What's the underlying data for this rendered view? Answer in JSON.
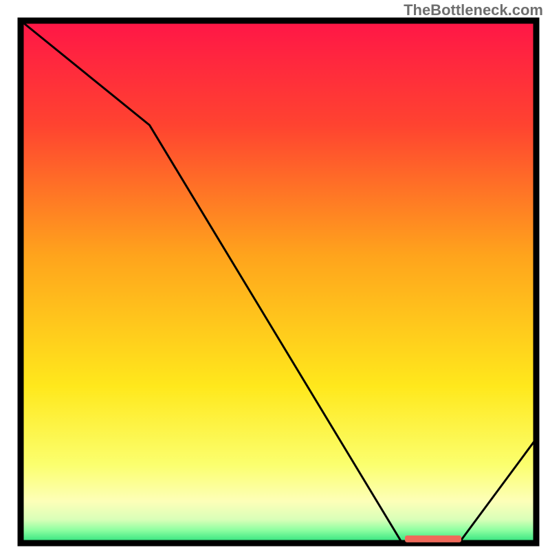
{
  "watermark": "TheBottleneck.com",
  "chart_data": {
    "type": "line",
    "title": "",
    "xlabel": "",
    "ylabel": "",
    "xlim": [
      0,
      100
    ],
    "ylim": [
      0,
      100
    ],
    "x": [
      0,
      25,
      74,
      80,
      85,
      100
    ],
    "values": [
      100,
      80,
      0,
      0,
      0,
      20
    ],
    "gradient_stops": [
      {
        "offset": 0.0,
        "color": "#ff1647"
      },
      {
        "offset": 0.2,
        "color": "#ff4330"
      },
      {
        "offset": 0.45,
        "color": "#ffa41c"
      },
      {
        "offset": 0.7,
        "color": "#ffe81c"
      },
      {
        "offset": 0.85,
        "color": "#fbff6e"
      },
      {
        "offset": 0.92,
        "color": "#fdffb8"
      },
      {
        "offset": 0.955,
        "color": "#d9ffb8"
      },
      {
        "offset": 0.975,
        "color": "#8effa1"
      },
      {
        "offset": 1.0,
        "color": "#26e07a"
      }
    ],
    "marker_text": "",
    "marker_x_frac": 0.8,
    "marker_y_frac": 0.992,
    "colors": {
      "line": "#000000",
      "border": "#000000",
      "marker_fill": "#f06a5a",
      "marker_text": "#ffffff"
    }
  }
}
